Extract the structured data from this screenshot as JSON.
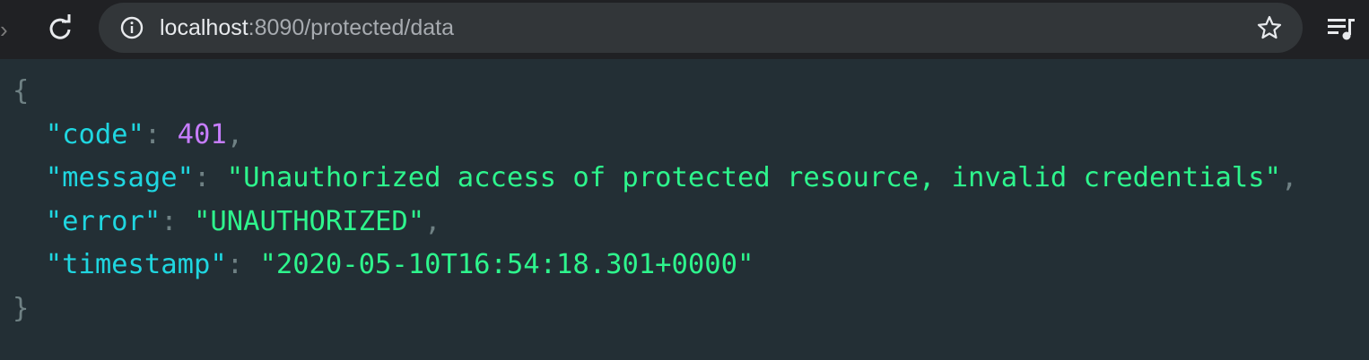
{
  "browser": {
    "url_host": "localhost",
    "url_rest": ":8090/protected/data",
    "icons": {
      "forward": "forward-icon",
      "reload": "reload-icon",
      "site_info": "info-icon",
      "bookmark": "star-icon",
      "reading_list": "reading-list-icon"
    }
  },
  "json": {
    "open_brace": "{",
    "close_brace": "}",
    "entries": [
      {
        "key": "\"code\"",
        "value": "401",
        "type": "number",
        "trailing": ","
      },
      {
        "key": "\"message\"",
        "value": "\"Unauthorized access of protected resource, invalid credentials\"",
        "type": "string",
        "trailing": ","
      },
      {
        "key": "\"error\"",
        "value": "\"UNAUTHORIZED\"",
        "type": "string",
        "trailing": ","
      },
      {
        "key": "\"timestamp\"",
        "value": "\"2020-05-10T16:54:18.301+0000\"",
        "type": "string",
        "trailing": ""
      }
    ]
  },
  "colors": {
    "background": "#232f35",
    "toolbar": "#202124",
    "omnibox": "#323639",
    "key": "#1fd6e0",
    "number": "#c77dff",
    "string": "#2ef58d",
    "punctuation": "#6f8184"
  }
}
